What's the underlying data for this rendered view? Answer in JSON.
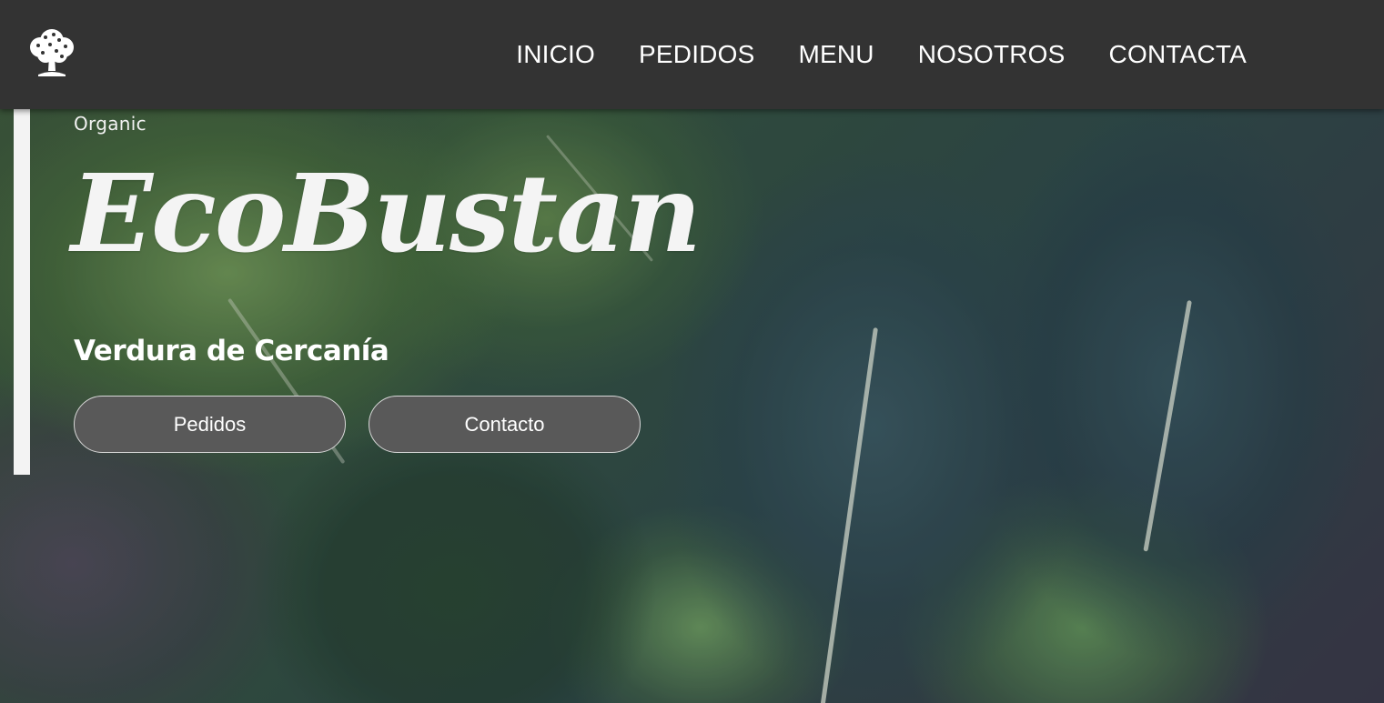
{
  "nav": {
    "logo_icon": "tree-icon",
    "links": [
      {
        "label": "INICIO"
      },
      {
        "label": "PEDIDOS"
      },
      {
        "label": "MENU"
      },
      {
        "label": "NOSOTROS"
      },
      {
        "label": "CONTACTA"
      }
    ],
    "background_color": "#333333",
    "text_color": "#ffffff"
  },
  "hero": {
    "eyebrow": "Organic",
    "title": "EcoBustan",
    "tagline": "Verdura de Cercanía",
    "buttons": [
      {
        "label": "Pedidos"
      },
      {
        "label": "Contacto"
      }
    ],
    "button_color": "#595959",
    "accent_bar_color": "#f3f3f3",
    "background_subject": "leafy-greens-photo"
  }
}
